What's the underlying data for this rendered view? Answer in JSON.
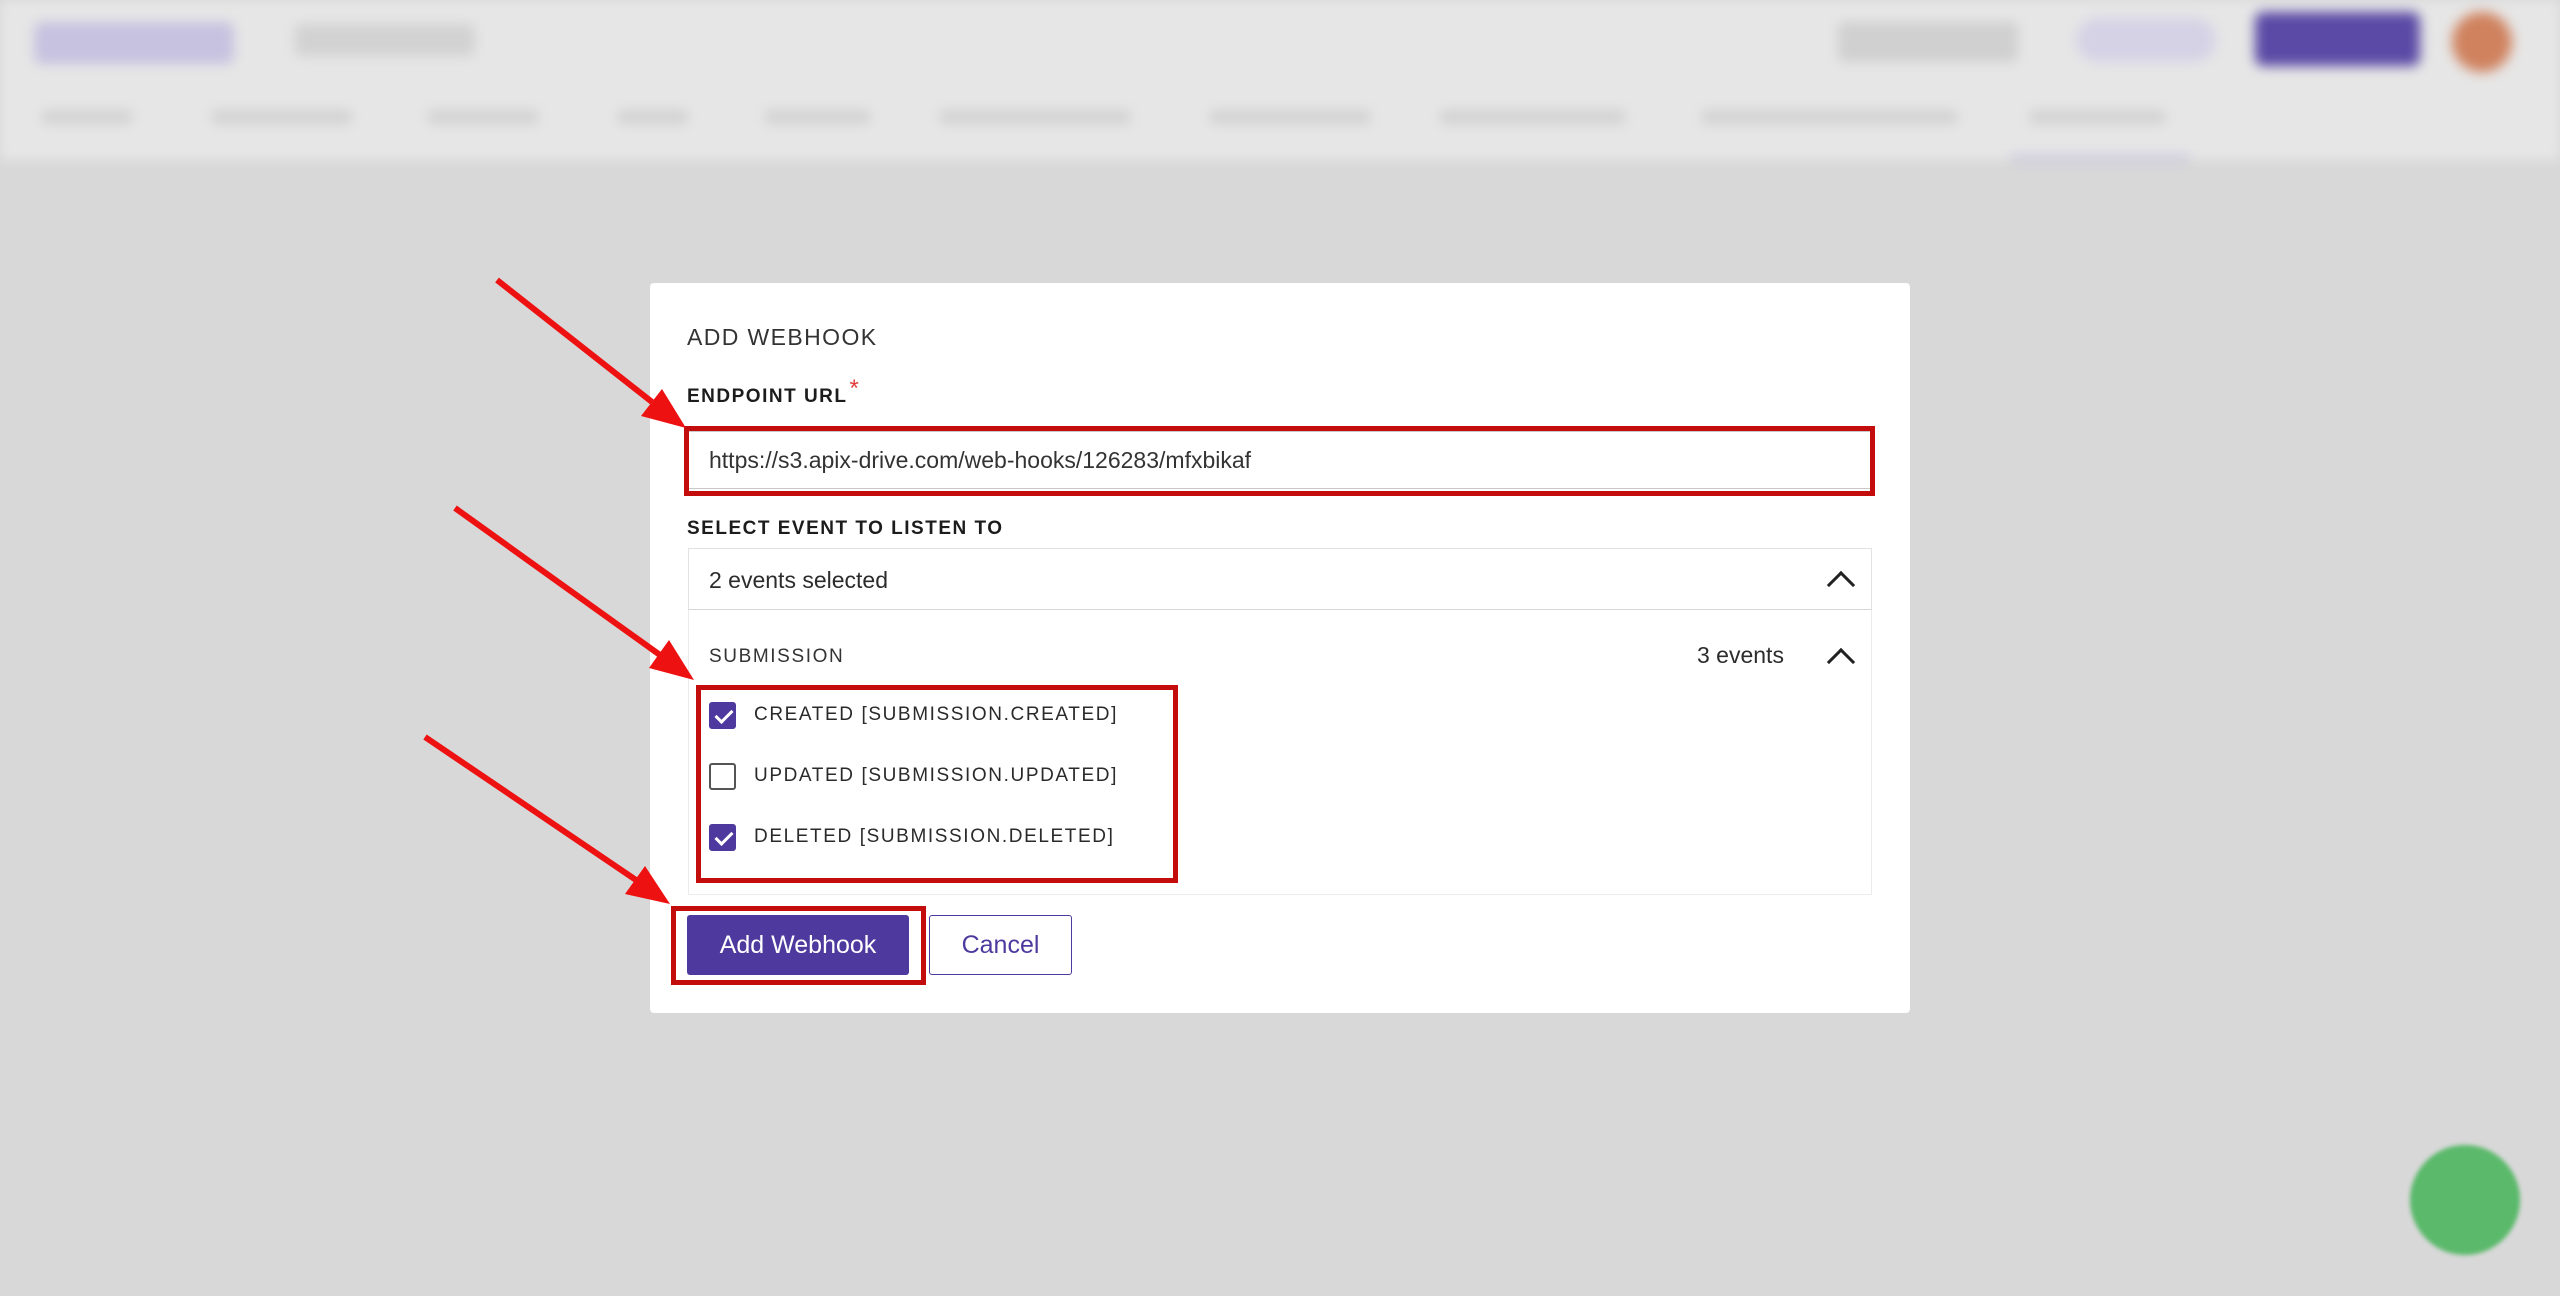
{
  "modal": {
    "title": "ADD WEBHOOK",
    "endpoint_label": "ENDPOINT URL",
    "required_mark": "*",
    "endpoint_value": "https://s3.apix-drive.com/web-hooks/126283/mfxbikaf",
    "event_select_label": "SELECT EVENT TO LISTEN TO",
    "event_select_value": "2 events selected",
    "event_group": {
      "name": "SUBMISSION",
      "count": "3 events",
      "events": [
        {
          "label": "CREATED [SUBMISSION.CREATED]",
          "checked": true
        },
        {
          "label": "UPDATED [SUBMISSION.UPDATED]",
          "checked": false
        },
        {
          "label": "DELETED [SUBMISSION.DELETED]",
          "checked": true
        }
      ]
    },
    "add_button_label": "Add Webhook",
    "cancel_button_label": "Cancel"
  },
  "colors": {
    "primary": "#4e3a9e",
    "annotation": "#c30d0d",
    "arrow": "#ee1111",
    "chat": "#5bb96b"
  },
  "icons": {
    "select_chevron": "chevron-up-icon",
    "group_chevron": "chevron-up-icon",
    "chat": "chat-icon"
  }
}
